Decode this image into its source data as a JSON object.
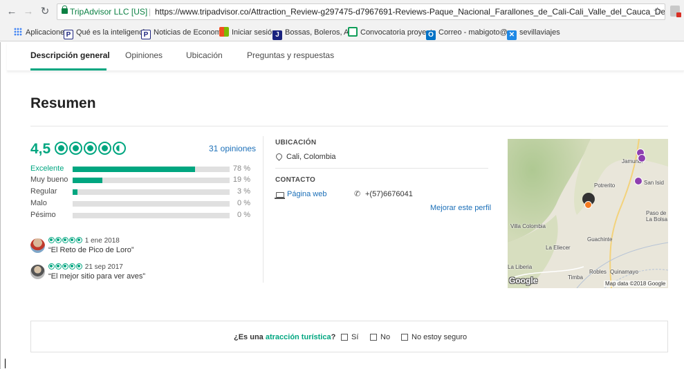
{
  "browser": {
    "secure_label": "TripAdvisor LLC [US]",
    "url": "https://www.tripadvisor.co/Attraction_Review-g297475-d7967691-Reviews-Paque_Nacional_Farallones_de_Cali-Cali_Valle_del_Cauca_Department.html",
    "bookmarks": [
      {
        "label": "Aplicaciones",
        "icon": "apps-icon"
      },
      {
        "label": "Qué es la inteligencia",
        "icon": "p-icon"
      },
      {
        "label": "Noticias de Economía",
        "icon": "p-icon"
      },
      {
        "label": "Iniciar sesión",
        "icon": "windows-icon"
      },
      {
        "label": "Bossas, Boleros, And",
        "icon": "j-icon"
      },
      {
        "label": "Convocatoria proyect",
        "icon": "sheet-icon"
      },
      {
        "label": "Correo - mabigoto@",
        "icon": "outlook-icon"
      },
      {
        "label": "sevillaviajes",
        "icon": "x-icon"
      }
    ]
  },
  "subnav": {
    "tabs": [
      "Descripción general",
      "Opiniones",
      "Ubicación",
      "Preguntas y respuestas"
    ],
    "active_tab": "Descripción general"
  },
  "summary": {
    "title": "Resumen",
    "rating": "4,5",
    "rating_value": 4.5,
    "reviews_link": "31 opiniones",
    "breakdown": [
      {
        "label": "Excelente",
        "pct": "78 %",
        "value": 78
      },
      {
        "label": "Muy bueno",
        "pct": "19 %",
        "value": 19
      },
      {
        "label": "Regular",
        "pct": "3 %",
        "value": 3
      },
      {
        "label": "Malo",
        "pct": "0 %",
        "value": 0
      },
      {
        "label": "Pésimo",
        "pct": "0 %",
        "value": 0
      }
    ],
    "reviews": [
      {
        "date": "1 ene 2018",
        "title": "“El Reto de Pico de Loro”",
        "rating": 5
      },
      {
        "date": "21 sep 2017",
        "title": "“El mejor sitio para ver aves”",
        "rating": 5
      }
    ]
  },
  "location": {
    "heading": "UBICACIÓN",
    "place": "Cali, Colombia"
  },
  "contact": {
    "heading": "CONTACTO",
    "web_label": "Página web",
    "phone": "+(57)6676041",
    "improve_link": "Mejorar este perfil"
  },
  "map": {
    "labels": [
      "Jamundí",
      "Potrerito",
      "San Isid",
      "Paso de",
      "La Bolsa",
      "Villa Colombia",
      "Guachinte",
      "La Eliecer",
      "La Liberia",
      "Robles",
      "Quinamayo",
      "Timba"
    ],
    "google": "Google",
    "attribution": "Map data ©2018 Google"
  },
  "question": {
    "prefix": "¿Es una ",
    "highlight": "atracción turística",
    "suffix": "?",
    "options": [
      "Sí",
      "No",
      "No estoy seguro"
    ]
  },
  "colors": {
    "accent": "#00a680",
    "link": "#1b6fb8"
  }
}
